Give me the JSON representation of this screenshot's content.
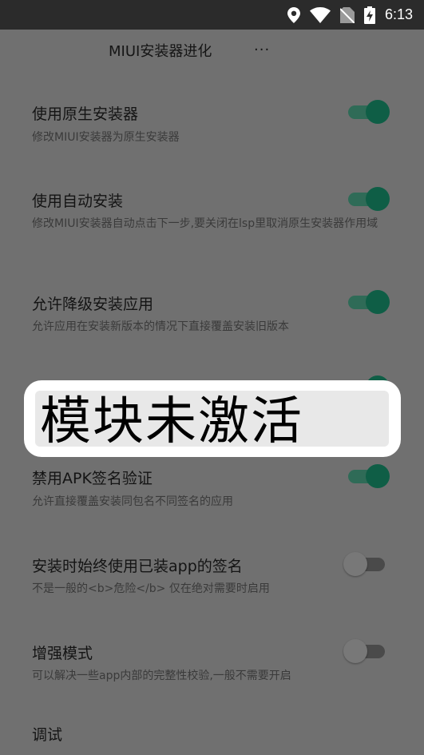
{
  "status_bar": {
    "time": "6:13",
    "icons": [
      "location-icon",
      "wifi-icon",
      "no-sim-icon",
      "battery-charging-icon"
    ]
  },
  "app_bar": {
    "title": "MIUI安装器进化",
    "overflow": "..."
  },
  "settings": [
    {
      "title": "使用原生安装器",
      "subtitle": "修改MIUI安装器为原生安装器",
      "enabled": true
    },
    {
      "title": "使用自动安装",
      "subtitle": "修改MIUI安装器自动点击下一步,要关闭在lsp里取消原生安装器作用域",
      "enabled": true
    },
    {
      "title": "允许降级安装应用",
      "subtitle": "允许应用在安装新版本的情况下直接覆盖安装旧版本",
      "enabled": true
    },
    {
      "title": "",
      "subtitle": "",
      "enabled": true
    },
    {
      "title": "禁用APK签名验证",
      "subtitle": "允许直接覆盖安装同包名不同签名的应用",
      "enabled": true
    },
    {
      "title": "安装时始终使用已装app的签名",
      "subtitle": "不是一般的<b>危险</b> 仅在绝对需要时启用",
      "enabled": false
    },
    {
      "title": "增强模式",
      "subtitle": "可以解决一些app内部的完整性校验,一般不需要开启",
      "enabled": false
    },
    {
      "title": "调试",
      "subtitle": ""
    }
  ],
  "toast": {
    "message": "模块未激活"
  },
  "colors": {
    "switch_on": "#0f5e46",
    "overlay": "#707070",
    "status_bar": "#2b2b2b"
  }
}
